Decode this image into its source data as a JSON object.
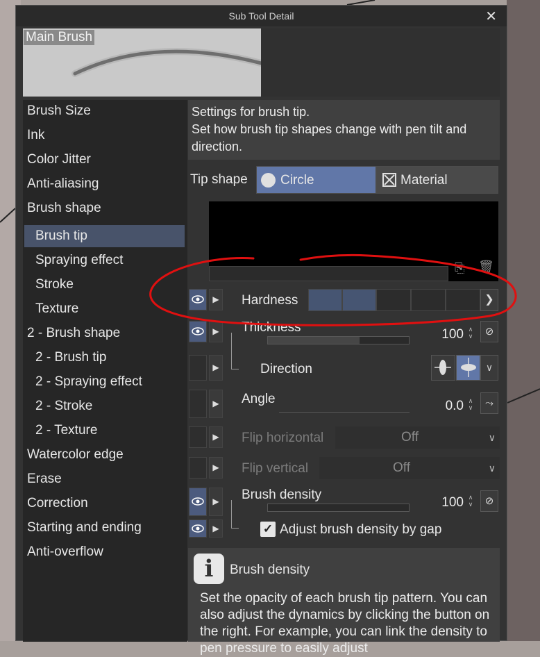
{
  "window": {
    "title": "Sub Tool Detail",
    "close_symbol": "✕"
  },
  "preview": {
    "label": "Main Brush"
  },
  "sidebar": {
    "items": [
      {
        "label": "Brush Size"
      },
      {
        "label": "Ink"
      },
      {
        "label": "Color Jitter"
      },
      {
        "label": "Anti-aliasing"
      },
      {
        "label": "Brush shape"
      },
      {
        "label": "Brush tip",
        "selected": true
      },
      {
        "label": "Spraying effect"
      },
      {
        "label": "Stroke"
      },
      {
        "label": "Texture"
      },
      {
        "label": "2 - Brush shape"
      },
      {
        "label": "2 - Brush tip"
      },
      {
        "label": "2 - Spraying effect"
      },
      {
        "label": "2 - Stroke"
      },
      {
        "label": "2 - Texture"
      },
      {
        "label": "Watercolor edge"
      },
      {
        "label": "Erase"
      },
      {
        "label": "Correction"
      },
      {
        "label": "Starting and ending"
      },
      {
        "label": "Anti-overflow"
      }
    ]
  },
  "panel": {
    "description": "Settings for brush tip.\nSet how brush tip shapes change with pen tilt and direction.",
    "tip_shape": {
      "label": "Tip shape",
      "options": [
        "Circle",
        "Material"
      ],
      "selected": "Circle"
    },
    "hardness": {
      "label": "Hardness",
      "level": 2,
      "levels": 5
    },
    "thickness": {
      "label": "Thickness",
      "value": "100",
      "fill": 0.65
    },
    "direction": {
      "label": "Direction"
    },
    "angle": {
      "label": "Angle",
      "value": "0.0"
    },
    "flip_horizontal": {
      "label": "Flip horizontal",
      "value": "Off"
    },
    "flip_vertical": {
      "label": "Flip vertical",
      "value": "Off"
    },
    "brush_density": {
      "label": "Brush density",
      "value": "100",
      "fill": 0.0
    },
    "adjust_density": {
      "label": "Adjust brush density by gap",
      "checked": true
    }
  },
  "info": {
    "title": "Brush density",
    "body": "Set the opacity of each brush tip pattern. You can also adjust the dynamics by clicking the button on the right. For example, you can link the density to pen pressure to easily adjust"
  },
  "colors": {
    "accent": "#6177a8",
    "selected": "#48536a",
    "annotation": "#e01010"
  }
}
